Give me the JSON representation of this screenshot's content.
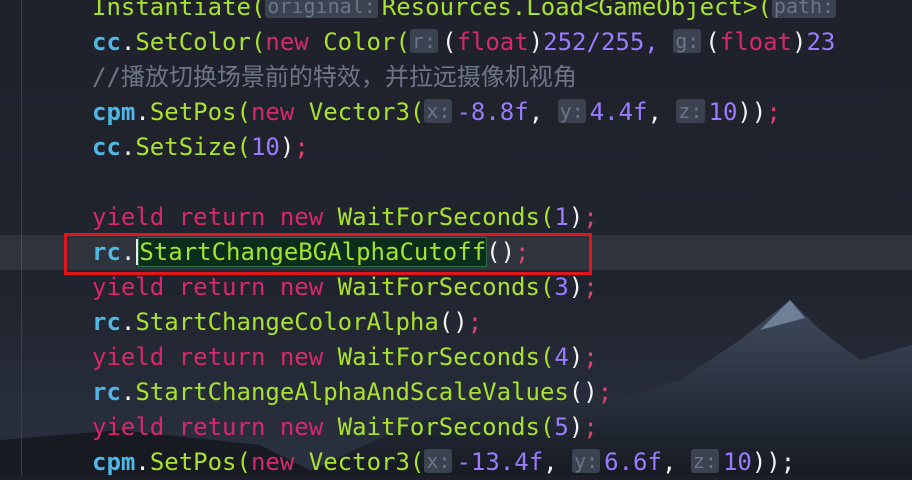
{
  "editor": {
    "colors": {
      "background": "#1c1f28",
      "keyword": "#d6286b",
      "identifier": "#4fb8e6",
      "method": "#a8e22e",
      "number": "#9a7bff",
      "comment": "#6e7587",
      "annotation_box": "#e0161c"
    },
    "lines": {
      "l1": {
        "a": "Instantiate(",
        "h1": "original:",
        "b": "Resources.",
        "c": "Load",
        "d": "<GameObject>(",
        "h2": "path:"
      },
      "l2": {
        "obj": "cc",
        "dot": ".",
        "fn": "SetColor(",
        "kw": "new ",
        "ty": "Color(",
        "h1": "r:",
        "p1": "(",
        "cast": "float",
        "p2": ")",
        "n": "252/255, ",
        "h2": "g:",
        "p3": "(",
        "cast2": "float",
        "p4": ")",
        "n2": "23"
      },
      "l3": {
        "comment": "//播放切换场景前的特效，并拉远摄像机视角"
      },
      "l4": {
        "obj": "cpm",
        "dot": ".",
        "fn": "SetPos(",
        "kw": "new ",
        "ty": "Vector3(",
        "h1": "x:",
        "v1": "-8.8f",
        "c1": ", ",
        "h2": "y:",
        "v2": "4.4f",
        "c2": ", ",
        "h3": "z:",
        "v3": "10",
        "end": "))",
        "semi": ";"
      },
      "l5": {
        "obj": "cc",
        "dot": ".",
        "fn": "SetSize(",
        "v1": "10",
        "end": ")",
        "semi": ";"
      },
      "l7": {
        "kw1": "yield ",
        "kw2": "return ",
        "kw3": "new ",
        "ty": "WaitForSeconds(",
        "v": "1",
        "end": ")",
        "semi": ";"
      },
      "l8": {
        "obj": "rc",
        "dot": ".",
        "fn": "StartChangeBGAlphaCutoff",
        "end": "()",
        "semi": ";"
      },
      "l9": {
        "kw1": "yield ",
        "kw2": "return ",
        "kw3": "new ",
        "ty": "WaitForSeconds(",
        "v": "3",
        "end": ")",
        "semi": ";"
      },
      "l10": {
        "obj": "rc",
        "dot": ".",
        "fn": "StartChangeColorAlpha",
        "end": "()",
        "semi": ";"
      },
      "l11": {
        "kw1": "yield ",
        "kw2": "return ",
        "kw3": "new ",
        "ty": "WaitForSeconds(",
        "v": "4",
        "end": ")",
        "semi": ";"
      },
      "l12": {
        "obj": "rc",
        "dot": ".",
        "fn": "StartChangeAlphaAndScaleValues",
        "end": "()",
        "semi": ";"
      },
      "l13": {
        "kw1": "yield ",
        "kw2": "return ",
        "kw3": "new ",
        "ty": "WaitForSeconds(",
        "v": "5",
        "end": ")",
        "semi": ";"
      },
      "l14": {
        "obj": "cpm",
        "dot": ".",
        "fn": "SetPos(",
        "kw": "new ",
        "ty": "Vector3(",
        "h1": "x:",
        "v1": "-13.4f",
        "c1": ", ",
        "h2": "y:",
        "v2": "6.6f",
        "c2": ", ",
        "h3": "z:",
        "v3": "10",
        "end": "));"
      }
    }
  }
}
